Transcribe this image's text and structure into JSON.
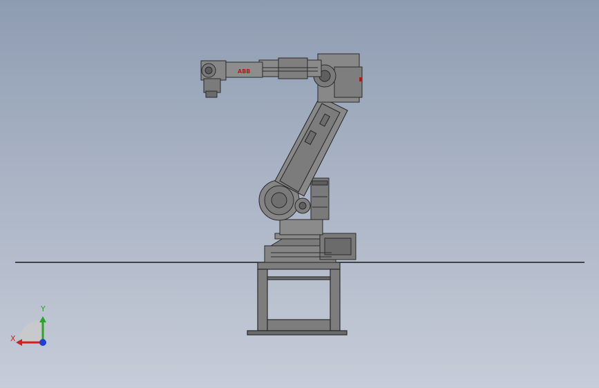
{
  "viewport": {
    "background_top": "#8e9cb2",
    "background_bottom": "#c6ccd8"
  },
  "model": {
    "type": "industrial-robot-arm",
    "brand_text": "ABB",
    "brand_color": "#b31b1b",
    "body_color": "#7d7d7d",
    "edge_color": "#2a2a2a"
  },
  "triad": {
    "y_label": "Y",
    "x_label": "X",
    "y_color": "#2aa52a",
    "x_color": "#d21f1f",
    "z_color": "#1f3fd2"
  }
}
